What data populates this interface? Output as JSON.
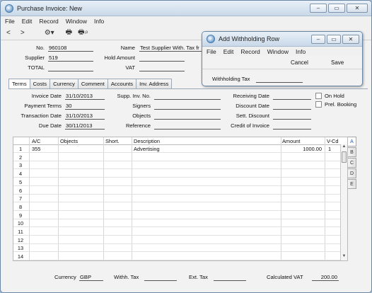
{
  "main_window": {
    "title": "Purchase Invoice: New",
    "menu": [
      "File",
      "Edit",
      "Record",
      "Window",
      "Info"
    ],
    "toolbar": {
      "prev": "<",
      "next": ">",
      "gear": "⚙▾",
      "print": "🖶",
      "print_preview": "🖶⌕"
    },
    "header": {
      "no_label": "No.",
      "no_value": "960108",
      "name_label": "Name",
      "name_value": "Test Supplier With. Tax fr",
      "supplier_label": "Supplier",
      "supplier_value": "519",
      "hold_amount_label": "Hold Amount",
      "hold_amount_value": "",
      "total_label": "TOTAL",
      "total_value": "",
      "vat_label": "VAT",
      "vat_value": ""
    },
    "tabs": [
      "Terms",
      "Costs",
      "Currency",
      "Comment",
      "Accounts",
      "Inv. Address"
    ],
    "terms": {
      "invoice_date_label": "Invoice Date",
      "invoice_date": "31/10/2013",
      "payment_terms_label": "Payment Terms",
      "payment_terms": "30",
      "transaction_date_label": "Transaction Date",
      "transaction_date": "31/10/2013",
      "due_date_label": "Due Date",
      "due_date": "30/11/2013",
      "supp_inv_no_label": "Supp. Inv. No.",
      "supp_inv_no": "",
      "signers_label": "Signers",
      "signers": "",
      "objects_label": "Objects",
      "objects": "",
      "reference_label": "Reference",
      "reference": "",
      "receiving_date_label": "Receiving Date",
      "receiving_date": "",
      "discount_date_label": "Discount Date",
      "discount_date": "",
      "sett_discount_label": "Sett. Discount",
      "sett_discount": "",
      "credit_of_invoice_label": "Credit of Invoice",
      "credit_of_invoice": "",
      "on_hold_label": "On Hold",
      "prel_booking_label": "Prel. Booking"
    },
    "grid": {
      "columns": [
        "A/C",
        "Objects",
        "Short.",
        "Description",
        "Amount",
        "V-Cd"
      ],
      "row_numbers": [
        "1",
        "2",
        "3",
        "4",
        "5",
        "6",
        "7",
        "8",
        "9",
        "10",
        "11",
        "12",
        "13",
        "14"
      ],
      "rows": [
        {
          "ac": "355",
          "objects": "",
          "short": "",
          "description": "Advertising",
          "amount": "1000.00",
          "vcd": "1"
        }
      ],
      "side_tabs": [
        "A",
        "B",
        "C",
        "D",
        "E"
      ]
    },
    "footer": {
      "currency_label": "Currency",
      "currency_value": "GBP",
      "withh_tax_label": "Withh. Tax",
      "withh_tax_value": "",
      "ext_tax_label": "Ext. Tax",
      "ext_tax_value": "",
      "calculated_vat_label": "Calculated VAT",
      "calculated_vat_value": "200.00"
    }
  },
  "dialog": {
    "title": "Add Withholding Row",
    "menu": [
      "File",
      "Edit",
      "Record",
      "Window",
      "Info"
    ],
    "cancel_label": "Cancel",
    "save_label": "Save",
    "withholding_tax_label": "Withholding Tax",
    "withholding_tax_value": ""
  }
}
